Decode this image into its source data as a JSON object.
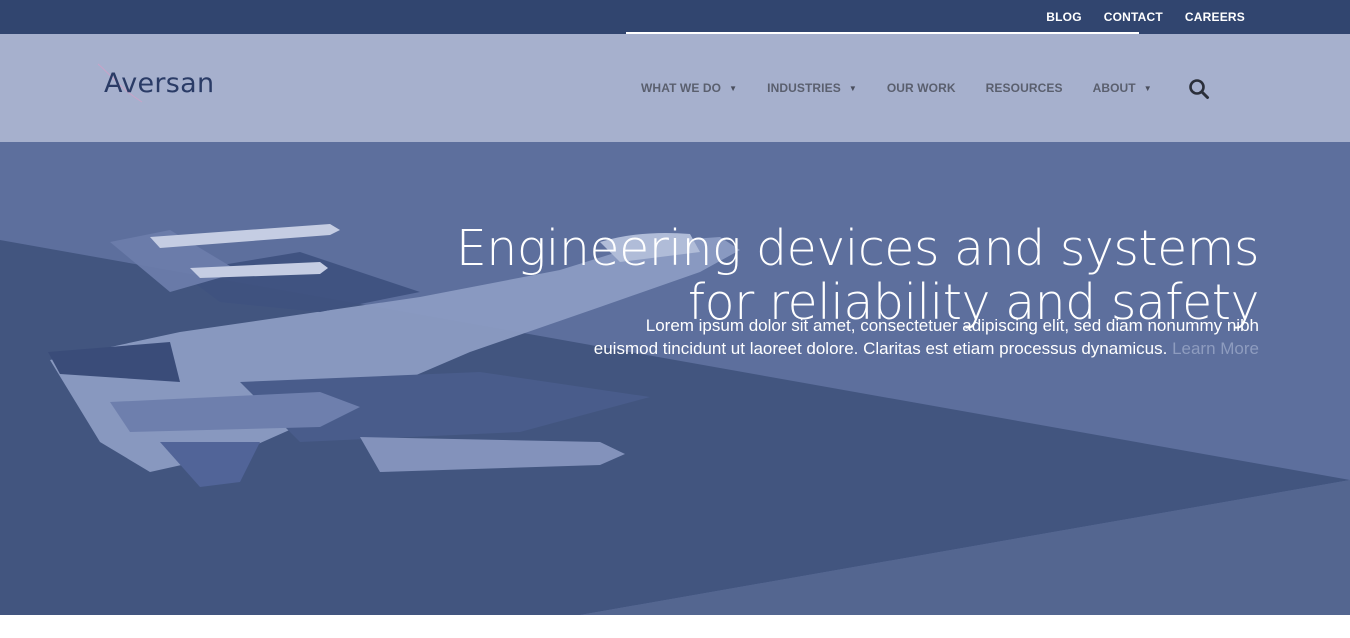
{
  "topbar": {
    "links": [
      "BLOG",
      "CONTACT",
      "CAREERS"
    ]
  },
  "header": {
    "logo_text": "Aversan",
    "nav": [
      {
        "label": "WHAT WE DO",
        "has_dropdown": true
      },
      {
        "label": "INDUSTRIES",
        "has_dropdown": true
      },
      {
        "label": "OUR WORK",
        "has_dropdown": false
      },
      {
        "label": "RESOURCES",
        "has_dropdown": false
      },
      {
        "label": "ABOUT",
        "has_dropdown": true
      }
    ],
    "search_icon": "search-icon"
  },
  "hero": {
    "heading": "Engineering devices and systems for reliability and safety",
    "text": "Lorem ipsum dolor sit amet, consectetuer adipiscing elit, sed diam nonummy nibh euismod tincidunt ut laoreet dolore. Claritas est etiam processus dynamicus.",
    "link": "Learn More"
  },
  "colors": {
    "topbar": "#31456f",
    "header": "#a6b0cd",
    "hero": "#5c6e9c",
    "hero_dark": "#42557f",
    "logo": "#2a3b66"
  }
}
